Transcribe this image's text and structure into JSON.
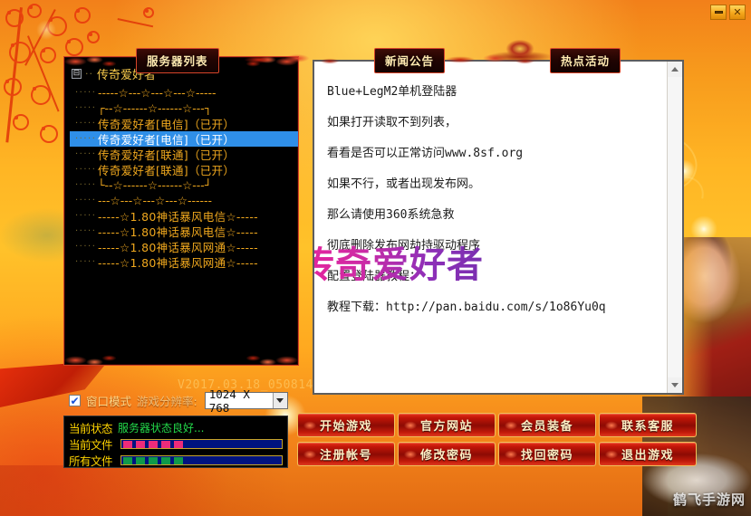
{
  "window": {
    "minimize_label": "—",
    "close_label": "✕"
  },
  "tabs": [
    {
      "id": "server",
      "label": "服务器列表"
    },
    {
      "id": "news",
      "label": "新闻公告"
    },
    {
      "id": "hot",
      "label": "热点活动"
    }
  ],
  "server_list": {
    "root_label": "传奇爱好者",
    "expander_glyph": "⊟",
    "root_dots": "··",
    "items": [
      {
        "guide": "·····",
        "label": "-----☆---☆---☆---☆-----",
        "type": "separator",
        "selected": false
      },
      {
        "guide": "·····",
        "label": "┌--☆------☆------☆---┐",
        "type": "separator",
        "selected": false
      },
      {
        "guide": "·····",
        "label": "传奇爱好者[电信]（已开）",
        "type": "server",
        "selected": false
      },
      {
        "guide": "·····",
        "label": "传奇爱好者[电信]（已开）",
        "type": "server",
        "selected": true
      },
      {
        "guide": "·····",
        "label": "传奇爱好者[联通]（已开）",
        "type": "server",
        "selected": false
      },
      {
        "guide": "·····",
        "label": "传奇爱好者[联通]（已开）",
        "type": "server",
        "selected": false
      },
      {
        "guide": "·····",
        "label": "└--☆------☆------☆---┘",
        "type": "separator",
        "selected": false
      },
      {
        "guide": "·····",
        "label": "---☆---☆---☆---☆------",
        "type": "separator",
        "selected": false
      },
      {
        "guide": "·····",
        "label": "-----☆1.80神话暴风电信☆-----",
        "type": "server",
        "selected": false
      },
      {
        "guide": "·····",
        "label": "-----☆1.80神话暴风电信☆-----",
        "type": "server",
        "selected": false
      },
      {
        "guide": "·····",
        "label": "-----☆1.80神话暴风网通☆-----",
        "type": "server",
        "selected": false
      },
      {
        "guide": "·····",
        "label": "-----☆1.80神话暴风网通☆-----",
        "type": "server",
        "selected": false
      }
    ]
  },
  "news": {
    "lines": [
      "Blue+LegM2单机登陆器",
      "如果打开读取不到列表，",
      "看看是否可以正常访问www.8sf.org",
      "如果不行，或者出现发布网。",
      "那么请使用360系统急救",
      "彻底删除发布网劫持驱动程序",
      "配置登陆器教程：",
      "教程下载：http://pan.baidu.com/s/1o86Yu0q"
    ],
    "watermark": "传奇爱好者"
  },
  "version": "V2017.03.18_050814",
  "options": {
    "window_mode_label": "窗口模式",
    "window_mode_checked": true,
    "check_glyph": "✔",
    "resolution_label": "游戏分辨率:",
    "resolution_value": "1024 X 768"
  },
  "status": {
    "current_state_label": "当前状态",
    "current_state_value": "服务器状态良好...",
    "current_file_label": "当前文件",
    "current_file_percent": 48,
    "current_file_color": "#ee2b7b",
    "all_files_label": "所有文件",
    "all_files_percent": 48,
    "all_files_color": "#0f9a4a",
    "bar_bg_color": "#00137f",
    "bar_border_color": "#c8a52a"
  },
  "buttons": [
    {
      "id": "start-game",
      "label": "开始游戏"
    },
    {
      "id": "official-site",
      "label": "官方网站"
    },
    {
      "id": "member-equipment",
      "label": "会员装备"
    },
    {
      "id": "contact-support",
      "label": "联系客服"
    },
    {
      "id": "register-account",
      "label": "注册帐号"
    },
    {
      "id": "change-password",
      "label": "修改密码"
    },
    {
      "id": "recover-password",
      "label": "找回密码"
    },
    {
      "id": "exit-game",
      "label": "退出游戏"
    }
  ],
  "site_watermark": "鹤飞手游网",
  "colors": {
    "background_orange": "#ffb524",
    "panel_black": "#000000",
    "tree_amber": "#f0a81e",
    "selection_blue": "#2f8fe8",
    "button_red": "#c11608",
    "button_gold_border": "#f0c05a"
  }
}
